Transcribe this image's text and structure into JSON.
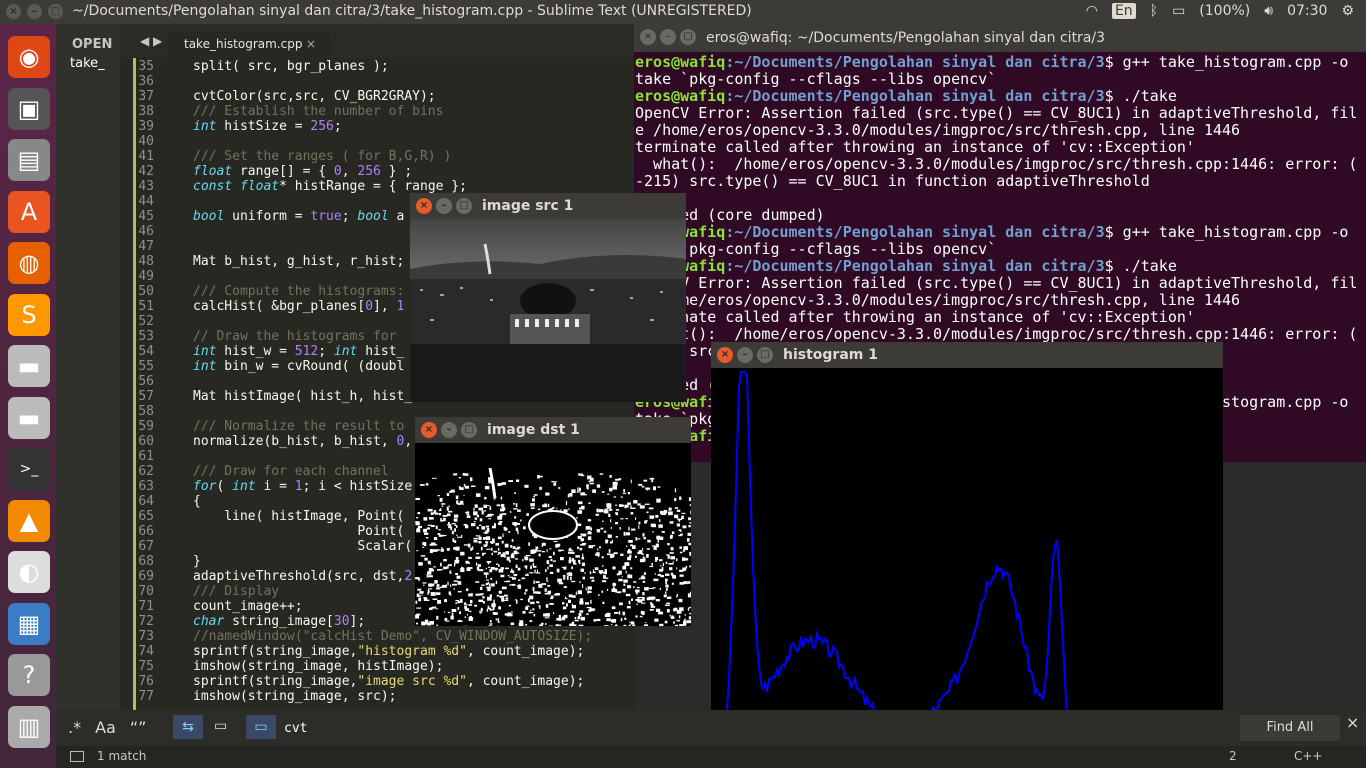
{
  "topbar": {
    "title": "~/Documents/Pengolahan sinyal dan citra/3/take_histogram.cpp - Sublime Text (UNREGISTERED)",
    "keyboard": "En",
    "battery": "(100%)",
    "time": "07:30"
  },
  "sublime": {
    "open_label": "OPEN",
    "sidebar_file": "take_",
    "tab_label": "take_histogram.cpp",
    "find_value": "cvt",
    "find_all": "Find All",
    "status_match": "1 match",
    "status_col": "2",
    "status_syntax": "C++",
    "find_opts": [
      ".*",
      "Aa",
      "“”"
    ],
    "lines": [
      {
        "n": "35",
        "t": "split( src, bgr_planes );"
      },
      {
        "n": "36",
        "t": ""
      },
      {
        "n": "37",
        "t": "cvtColor(src,src, CV_BGR2GRAY);"
      },
      {
        "n": "38",
        "t": "/// Establish the number of bins"
      },
      {
        "n": "39",
        "t": "int histSize = 256;"
      },
      {
        "n": "40",
        "t": ""
      },
      {
        "n": "41",
        "t": "/// Set the ranges ( for B,G,R) )"
      },
      {
        "n": "42",
        "t": "float range[] = { 0, 256 } ;"
      },
      {
        "n": "43",
        "t": "const float* histRange = { range };"
      },
      {
        "n": "44",
        "t": ""
      },
      {
        "n": "45",
        "t": "bool uniform = true; bool a"
      },
      {
        "n": "46",
        "t": ""
      },
      {
        "n": "47",
        "t": ""
      },
      {
        "n": "48",
        "t": "Mat b_hist, g_hist, r_hist;"
      },
      {
        "n": "49",
        "t": ""
      },
      {
        "n": "50",
        "t": "/// Compute the histograms:"
      },
      {
        "n": "51",
        "t": "calcHist( &bgr_planes[0], 1"
      },
      {
        "n": "52",
        "t": ""
      },
      {
        "n": "53",
        "t": "// Draw the histograms for"
      },
      {
        "n": "54",
        "t": "int hist_w = 512; int hist_"
      },
      {
        "n": "55",
        "t": "int bin_w = cvRound( (doubl"
      },
      {
        "n": "56",
        "t": ""
      },
      {
        "n": "57",
        "t": "Mat histImage( hist_h, hist_"
      },
      {
        "n": "58",
        "t": ""
      },
      {
        "n": "59",
        "t": "/// Normalize the result to"
      },
      {
        "n": "60",
        "t": "normalize(b_hist, b_hist, 0,"
      },
      {
        "n": "61",
        "t": ""
      },
      {
        "n": "62",
        "t": "/// Draw for each channel"
      },
      {
        "n": "63",
        "t": "for( int i = 1; i < histSize"
      },
      {
        "n": "64",
        "t": "{"
      },
      {
        "n": "65",
        "t": "    line( histImage, Point("
      },
      {
        "n": "66",
        "t": "                     Point("
      },
      {
        "n": "67",
        "t": "                     Scalar("
      },
      {
        "n": "68",
        "t": "}"
      },
      {
        "n": "69",
        "t": "adaptiveThreshold(src, dst,2"
      },
      {
        "n": "70",
        "t": "/// Display"
      },
      {
        "n": "71",
        "t": "count_image++;"
      },
      {
        "n": "72",
        "t": "char string_image[30];"
      },
      {
        "n": "73",
        "t": "//namedWindow(\"calcHist Demo\", CV_WINDOW_AUTOSIZE);"
      },
      {
        "n": "74",
        "t": "sprintf(string_image,\"histogram %d\", count_image);"
      },
      {
        "n": "75",
        "t": "imshow(string_image, histImage);"
      },
      {
        "n": "76",
        "t": "sprintf(string_image,\"image src %d\", count_image);"
      },
      {
        "n": "77",
        "t": "imshow(string_image, src);"
      }
    ]
  },
  "terminal": {
    "title": "eros@wafiq: ~/Documents/Pengolahan sinyal dan citra/3",
    "prompt_user": "eros@wafiq",
    "prompt_path": ":~/Documents/Pengolahan sinyal dan citra/3",
    "lines": [
      {
        "p": true,
        "t": "$ g++ take_histogram.cpp -o"
      },
      {
        "p": false,
        "t": "take `pkg-config --cflags --libs opencv`"
      },
      {
        "p": true,
        "t": "$ ./take"
      },
      {
        "p": false,
        "t": "OpenCV Error: Assertion failed (src.type() == CV_8UC1) in adaptiveThreshold, fil"
      },
      {
        "p": false,
        "t": "e /home/eros/opencv-3.3.0/modules/imgproc/src/thresh.cpp, line 1446"
      },
      {
        "p": false,
        "t": "terminate called after throwing an instance of 'cv::Exception'"
      },
      {
        "p": false,
        "t": "  what():  /home/eros/opencv-3.3.0/modules/imgproc/src/thresh.cpp:1446: error: ("
      },
      {
        "p": false,
        "t": "-215) src.type() == CV_8UC1 in function adaptiveThreshold"
      },
      {
        "p": false,
        "t": ""
      },
      {
        "p": false,
        "t": "Aborted (core dumped)"
      },
      {
        "p": true,
        "t": "$ g++ take_histogram.cpp -o"
      },
      {
        "p": false,
        "t": "take `pkg-config --cflags --libs opencv`"
      },
      {
        "p": true,
        "t": "$ ./take"
      },
      {
        "p": false,
        "t": "OpenCV Error: Assertion failed (src.type() == CV_8UC1) in adaptiveThreshold, fil"
      },
      {
        "p": false,
        "t": "e /home/eros/opencv-3.3.0/modules/imgproc/src/thresh.cpp, line 1446"
      },
      {
        "p": false,
        "t": "terminate called after throwing an instance of 'cv::Exception'"
      },
      {
        "p": false,
        "t": "  what():  /home/eros/opencv-3.3.0/modules/imgproc/src/thresh.cpp:1446: error: ("
      },
      {
        "p": false,
        "t": "-215) src.type() == CV_8UC1 in function adaptiveThreshold"
      },
      {
        "p": false,
        "t": ""
      },
      {
        "p": false,
        "t": "Aborted (core dumped)"
      },
      {
        "p": true,
        "t": "$ g++ take_histogram.cpp -o"
      },
      {
        "p": false,
        "t": "take `pkg-config --cflags --libs opencv`"
      },
      {
        "p": true,
        "t": "$ "
      }
    ]
  },
  "windows": {
    "src_title": "image src 1",
    "dst_title": "image dst 1",
    "hist_title": "histogram 1"
  },
  "colors": {
    "histogram_line": "#0000ff",
    "terminal_bg": "#300a24",
    "launcher": "#5b2547"
  },
  "launcher_icons": [
    "ubuntu-icon",
    "workspace-icon",
    "files-icon",
    "software-center-icon",
    "firefox-icon",
    "sublime-icon",
    "drive-icon",
    "drive-icon",
    "terminal-icon",
    "vlc-icon",
    "libreoffice-icon",
    "image-viewer-icon",
    "help-icon",
    "trash-icon"
  ]
}
